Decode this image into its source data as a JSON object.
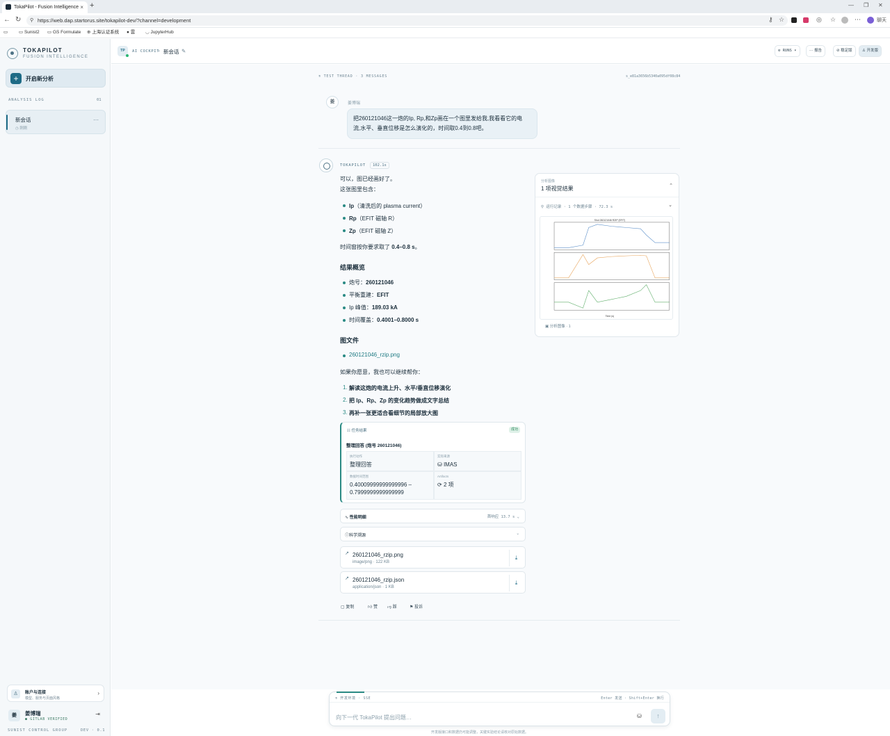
{
  "browser": {
    "tab_title": "TokaPilot - Fusion Intelligence",
    "url": "https://web.dap.startorus.site/tokapilot-dev/?channel=development",
    "bookmarks": [
      "Sunist2",
      "GS Formulate",
      "上海认证系统",
      "雲",
      "JupyterHub"
    ],
    "profile_label": "聊天"
  },
  "sidebar": {
    "brand_name": "TOKAPILOT",
    "brand_sub": "FUSION INTELLIGENCE",
    "new_analysis": "开启新分析",
    "log_header": "ANALYSIS LOG",
    "log_count": "01",
    "session": {
      "title": "新会话",
      "sub": "刚刚"
    },
    "account": {
      "title": "账户与连接",
      "sub": "模型、服务与页面风格"
    },
    "user": {
      "avatar": "姜",
      "name": "姜博瑞",
      "verified": "GITLAB VERIFIED"
    },
    "group": "SUNIST CONTROL GROUP",
    "version": "DEV · 0.1"
  },
  "header": {
    "badge": "TP",
    "cockpit": "AI COCKPIT",
    "title": "新会话",
    "runs": "RUNS",
    "report": "报告",
    "mode_a": "稳定版",
    "mode_b": "开发版"
  },
  "thread": {
    "label": "TEST THREAD · 3 MESSAGES",
    "id": "s_e81a3656b5340a095df08c84"
  },
  "user_msg": {
    "avatar": "姜",
    "name": "姜博瑞",
    "line1": "把260121046这一炮的Ip, Rp,和Zp画在一个图里发给我,我看看它的电",
    "line2": "流,水平、垂直位移是怎么演化的，时间取0.4到0.8吧。"
  },
  "bot": {
    "name": "TOKAPILOT",
    "time": "102.1s",
    "intro1": "可以，图已经画好了。",
    "intro2": "这张图里包含：",
    "items": [
      {
        "b": "Ip",
        "t": "（清洗后的 plasma current）"
      },
      {
        "b": "Rp",
        "t": "（EFIT 磁轴 R）"
      },
      {
        "b": "Zp",
        "t": "（EFIT 磁轴 Z）"
      }
    ],
    "window_pre": "时间窗按你要求取了 ",
    "window_b": "0.4–0.8 s",
    "window_post": "。",
    "summary_title": "结果概览",
    "summary": [
      {
        "k": "炮号：",
        "v": "260121046"
      },
      {
        "k": "平衡重建：",
        "v": "EFIT"
      },
      {
        "k": "Ip 峰值：",
        "v": "189.03 kA"
      },
      {
        "k": "时间覆盖：",
        "v": "0.4001–0.8000 s"
      }
    ],
    "files_title": "图文件",
    "file_link": "260121046_rzip.png",
    "more": "如果你愿意，我也可以继续帮你：",
    "options": [
      "解读这炮的电流上升、水平/垂直位移演化",
      "把 Ip、Rp、Zp 的变化趋势做成文字总结",
      "再补一张更适合看细节的局部放大图"
    ]
  },
  "task": {
    "header": "任务结果",
    "status": "成功",
    "title": "整理回答 (炮号 260121046)",
    "action_label": "执行动作",
    "action_value": "整理回答",
    "source_label": "实际来源",
    "source_value": "IMAS",
    "range_label": "数据时间范围",
    "range_value1": "0.40009999999999996 –",
    "range_value2": "0.7999999999999999",
    "artifacts_label": "Artifacts",
    "artifacts_value": "2 项"
  },
  "perf": {
    "label": "性能明细",
    "value": "首响应 13.7 s"
  },
  "sources": {
    "label": "科学溯源"
  },
  "files": [
    {
      "name": "260121046_rzip.png",
      "meta": "image/png · 122 KB"
    },
    {
      "name": "260121046_rzip.json",
      "meta": "application/json · 1 KB"
    }
  ],
  "feedback": {
    "copy": "复制",
    "like": "赞",
    "dislike": "踩",
    "report": "投诉"
  },
  "panel": {
    "label": "分析图像",
    "title": "1 项视觉结果",
    "run": "运行记录 · 1 个数据步骤 · 72.3 s",
    "footer": "分析图像 · 1",
    "plot_title": "Shot 260121046 RZIP (EFIT)",
    "xlabel": "Time (s)"
  },
  "composer": {
    "env": "开发环境 · SSE",
    "hint": "Enter 发送 · Shift+Enter 换行",
    "placeholder": "向下一代 TokaPilot 提出问题…",
    "disclaimer": "开发版接口和数据仍可能调整，关键实验结论请核对原始数据。"
  },
  "colors": {
    "accent": "#2a8a84",
    "brand": "#1e6b86",
    "ip": "#5b8fc9",
    "rp": "#e8a55c",
    "zp": "#5fae6a"
  },
  "chart_data": {
    "type": "line",
    "title": "Shot 260121046 RZIP (EFIT)",
    "xlabel": "Time (s)",
    "x": [
      0.4,
      0.45,
      0.5,
      0.52,
      0.55,
      0.6,
      0.65,
      0.7,
      0.72,
      0.75,
      0.8
    ],
    "series": [
      {
        "name": "Ip",
        "values": [
          0,
          0,
          20,
          160,
          185,
          170,
          160,
          150,
          100,
          40,
          40
        ]
      },
      {
        "name": "Rp",
        "values": [
          0,
          0,
          0.35,
          0.2,
          0.3,
          0.32,
          0.33,
          0.34,
          0.33,
          0,
          0
        ]
      },
      {
        "name": "Zp",
        "values": [
          0,
          0,
          -0.01,
          0.02,
          0.0,
          0.005,
          0.01,
          0.02,
          0.03,
          0,
          0
        ]
      }
    ]
  }
}
